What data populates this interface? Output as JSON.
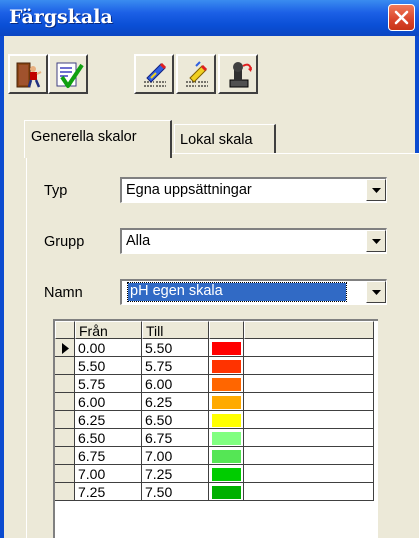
{
  "window": {
    "title": "Färgskala"
  },
  "toolbar": {
    "buttons": [
      {
        "icon": "exit-door-icon"
      },
      {
        "icon": "checklist-ok-icon"
      },
      {
        "icon": "edit-list-icon"
      },
      {
        "icon": "edit-list-alt-icon"
      },
      {
        "icon": "undo-stamp-icon"
      }
    ]
  },
  "tabs": [
    {
      "label": "Generella skalor",
      "active": true
    },
    {
      "label": "Lokal skala",
      "active": false
    }
  ],
  "form": {
    "typ": {
      "label": "Typ",
      "value": "Egna uppsättningar"
    },
    "grupp": {
      "label": "Grupp",
      "value": "Alla"
    },
    "namn": {
      "label": "Namn",
      "value": "pH egen skala"
    }
  },
  "table": {
    "headers": [
      "Från",
      "Till",
      ""
    ],
    "rows": [
      {
        "from": "0.00",
        "to": "5.50",
        "color": "#ff0000",
        "current": true
      },
      {
        "from": "5.50",
        "to": "5.75",
        "color": "#ff3300"
      },
      {
        "from": "5.75",
        "to": "6.00",
        "color": "#ff6600"
      },
      {
        "from": "6.00",
        "to": "6.25",
        "color": "#ffaa00"
      },
      {
        "from": "6.25",
        "to": "6.50",
        "color": "#ffff00"
      },
      {
        "from": "6.50",
        "to": "6.75",
        "color": "#80ff80"
      },
      {
        "from": "6.75",
        "to": "7.00",
        "color": "#55e655"
      },
      {
        "from": "7.00",
        "to": "7.25",
        "color": "#00cc00"
      },
      {
        "from": "7.25",
        "to": "7.50",
        "color": "#00b000"
      }
    ]
  },
  "colors": {
    "titlebar": "#0a4fd6",
    "selection": "#316ac5",
    "close": "#d9442a"
  }
}
